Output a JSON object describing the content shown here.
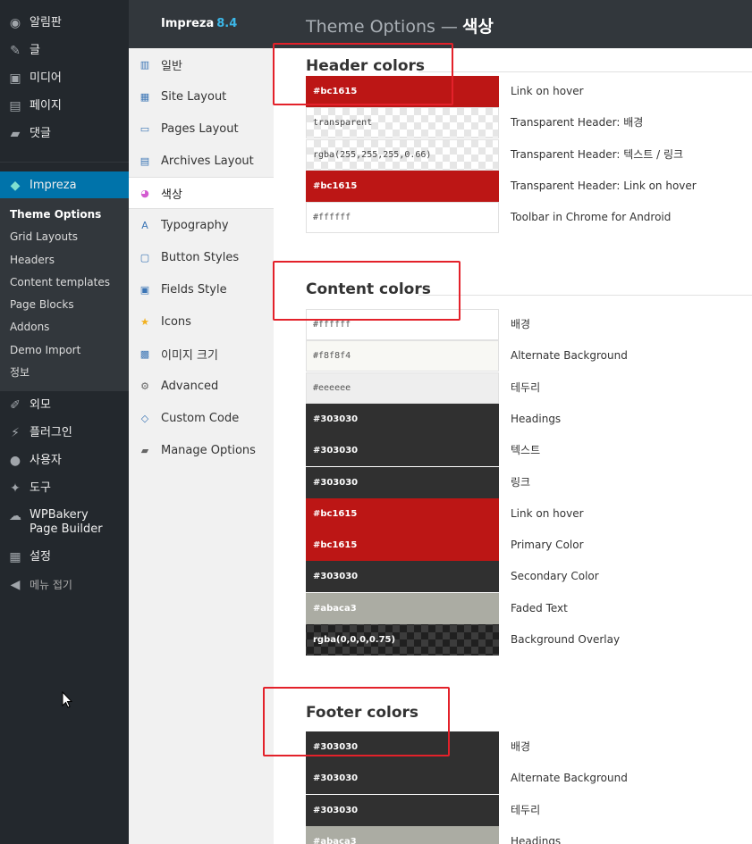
{
  "wp_menu": {
    "items_top": [
      {
        "label": "알림판",
        "icon": "dashboard-icon",
        "glyph": "◉"
      },
      {
        "label": "글",
        "icon": "pin-icon",
        "glyph": "✎"
      },
      {
        "label": "미디어",
        "icon": "media-icon",
        "glyph": "▣"
      },
      {
        "label": "페이지",
        "icon": "page-icon",
        "glyph": "▤"
      },
      {
        "label": "댓글",
        "icon": "comment-icon",
        "glyph": "▰"
      }
    ],
    "active": {
      "label": "Impreza",
      "icon": "diamond-icon",
      "glyph": "◆"
    },
    "submenu": [
      "Theme Options",
      "Grid Layouts",
      "Headers",
      "Content templates",
      "Page Blocks",
      "Addons",
      "Demo Import",
      "정보"
    ],
    "items_bottom": [
      {
        "label": "외모",
        "icon": "brush-icon",
        "glyph": "✐"
      },
      {
        "label": "플러그인",
        "icon": "plugin-icon",
        "glyph": "⚡"
      },
      {
        "label": "사용자",
        "icon": "user-icon",
        "glyph": "●"
      },
      {
        "label": "도구",
        "icon": "wrench-icon",
        "glyph": "✦"
      },
      {
        "label": "WPBakery Page Builder",
        "icon": "cloud-icon",
        "glyph": "☁"
      },
      {
        "label": "설정",
        "icon": "settings-icon",
        "glyph": "▦"
      }
    ],
    "collapse": {
      "label": "메뉴 접기",
      "icon": "collapse-icon",
      "glyph": "◀"
    }
  },
  "options_nav": {
    "brand": "Impreza",
    "version": "8.4",
    "items": [
      {
        "label": "일반",
        "icon": "chart-icon",
        "glyph": "▥"
      },
      {
        "label": "Site Layout",
        "icon": "layout-icon",
        "glyph": "▦"
      },
      {
        "label": "Pages Layout",
        "icon": "pages-layout-icon",
        "glyph": "▭"
      },
      {
        "label": "Archives Layout",
        "icon": "archives-icon",
        "glyph": "▤"
      },
      {
        "label": "색상",
        "icon": "color-wheel-icon",
        "glyph": "◕"
      },
      {
        "label": "Typography",
        "icon": "typography-icon",
        "glyph": "A"
      },
      {
        "label": "Button Styles",
        "icon": "button-styles-icon",
        "glyph": "▢"
      },
      {
        "label": "Fields Style",
        "icon": "fields-icon",
        "glyph": "▣"
      },
      {
        "label": "Icons",
        "icon": "star-icon",
        "glyph": "★"
      },
      {
        "label": "이미지 크기",
        "icon": "image-icon",
        "glyph": "▩"
      },
      {
        "label": "Advanced",
        "icon": "gear-icon",
        "glyph": "⚙"
      },
      {
        "label": "Custom Code",
        "icon": "code-icon",
        "glyph": "◇"
      },
      {
        "label": "Manage Options",
        "icon": "manage-icon",
        "glyph": "▰"
      }
    ],
    "active_index": 4
  },
  "top_bar": {
    "title": "Theme Options —",
    "section": "색상"
  },
  "sections": {
    "header": {
      "title": "Header colors",
      "rows": [
        {
          "value": "#bc1615",
          "label": "Link on hover",
          "bg": "#bc1615",
          "style": "dark"
        },
        {
          "value": "transparent",
          "label": "Transparent Header: 배경",
          "bg": "",
          "style": "checker"
        },
        {
          "value": "rgba(255,255,255,0.66)",
          "label": "Transparent Header: 텍스트 / 링크",
          "bg": "",
          "style": "checker"
        },
        {
          "value": "#bc1615",
          "label": "Transparent Header: Link on hover",
          "bg": "#bc1615",
          "style": "dark"
        },
        {
          "value": "#ffffff",
          "label": "Toolbar in Chrome for Android",
          "bg": "#ffffff",
          "style": "light"
        }
      ]
    },
    "content": {
      "title": "Content colors",
      "rows": [
        {
          "value": "#ffffff",
          "label": "배경",
          "bg": "#ffffff",
          "style": "light"
        },
        {
          "value": "#f8f8f4",
          "label": "Alternate Background",
          "bg": "#f8f8f4",
          "style": "light"
        },
        {
          "value": "#eeeeee",
          "label": "테두리",
          "bg": "#eeeeee",
          "style": "light"
        },
        {
          "value": "#303030",
          "label": "Headings",
          "bg": "#303030",
          "style": "dark"
        },
        {
          "value": "#303030",
          "label": "텍스트",
          "bg": "#303030",
          "style": "dark"
        },
        {
          "value": "#303030",
          "label": "링크",
          "bg": "#303030",
          "style": "dark"
        },
        {
          "value": "#bc1615",
          "label": "Link on hover",
          "bg": "#bc1615",
          "style": "dark"
        },
        {
          "value": "#bc1615",
          "label": "Primary Color",
          "bg": "#bc1615",
          "style": "dark"
        },
        {
          "value": "#303030",
          "label": "Secondary Color",
          "bg": "#303030",
          "style": "dark"
        },
        {
          "value": "#abaca3",
          "label": "Faded Text",
          "bg": "#abaca3",
          "style": "dark"
        },
        {
          "value": "rgba(0,0,0,0.75)",
          "label": "Background Overlay",
          "bg": "",
          "style": "checker-dark"
        }
      ]
    },
    "footer": {
      "title": "Footer colors",
      "rows": [
        {
          "value": "#303030",
          "label": "배경",
          "bg": "#303030",
          "style": "dark"
        },
        {
          "value": "#303030",
          "label": "Alternate Background",
          "bg": "#303030",
          "style": "dark"
        },
        {
          "value": "#303030",
          "label": "테두리",
          "bg": "#303030",
          "style": "dark"
        },
        {
          "value": "#abaca3",
          "label": "Headings",
          "bg": "#abaca3",
          "style": "dark"
        }
      ]
    }
  },
  "colors": {
    "wp_sidebar": "#23282d",
    "wp_active": "#0073aa",
    "annotation_red": "#e3212a"
  }
}
